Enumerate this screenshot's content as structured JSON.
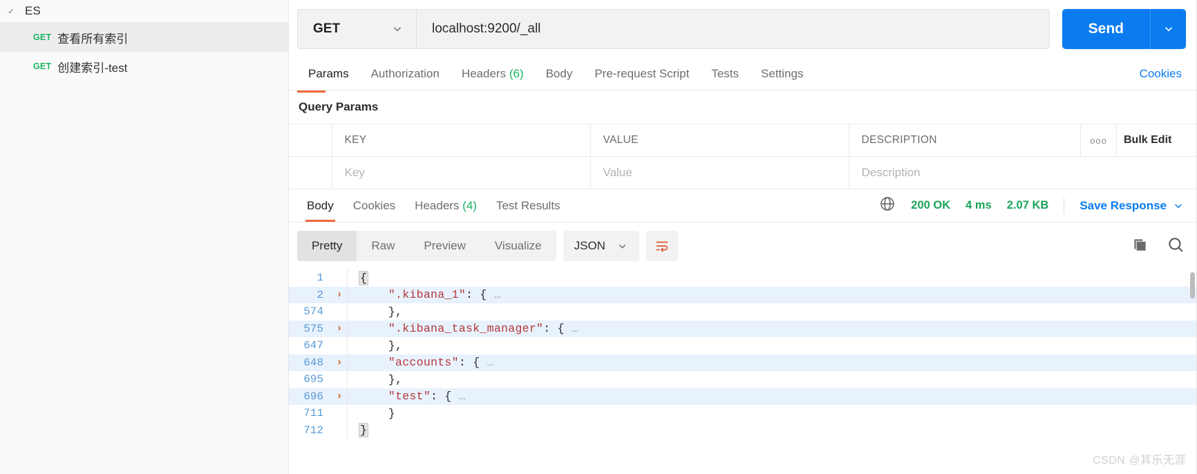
{
  "sidebar": {
    "collection": {
      "name": "ES",
      "chevron_icon": "chevron-down-icon"
    },
    "requests": [
      {
        "method": "GET",
        "label": "查看所有索引",
        "selected": true
      },
      {
        "method": "GET",
        "label": "创建索引-test",
        "selected": false
      }
    ]
  },
  "request": {
    "method": "GET",
    "url": "localhost:9200/_all",
    "send_label": "Send",
    "tabs": [
      {
        "label": "Params",
        "active": true
      },
      {
        "label": "Authorization",
        "active": false
      },
      {
        "label": "Headers",
        "count": "(6)",
        "active": false
      },
      {
        "label": "Body",
        "active": false
      },
      {
        "label": "Pre-request Script",
        "active": false
      },
      {
        "label": "Tests",
        "active": false
      },
      {
        "label": "Settings",
        "active": false
      }
    ],
    "cookies_link": "Cookies"
  },
  "query_params": {
    "title": "Query Params",
    "headers": [
      "KEY",
      "VALUE",
      "DESCRIPTION"
    ],
    "dots_label": "ooo",
    "bulk_edit_label": "Bulk Edit",
    "placeholders": {
      "key": "Key",
      "value": "Value",
      "description": "Description"
    }
  },
  "response": {
    "tabs": [
      {
        "label": "Body",
        "active": true
      },
      {
        "label": "Cookies",
        "active": false
      },
      {
        "label": "Headers",
        "count": "(4)",
        "active": false
      },
      {
        "label": "Test Results",
        "active": false
      }
    ],
    "globe_icon": "globe-icon",
    "status": "200 OK",
    "time": "4 ms",
    "size": "2.07 KB",
    "save_response_label": "Save Response",
    "view_modes": [
      {
        "label": "Pretty",
        "active": true
      },
      {
        "label": "Raw",
        "active": false
      },
      {
        "label": "Preview",
        "active": false
      },
      {
        "label": "Visualize",
        "active": false
      }
    ],
    "format": "JSON",
    "wrap_icon": "wrap-lines-icon",
    "copy_icon": "copy-icon",
    "search_icon": "search-icon",
    "body_lines": [
      {
        "num": "1",
        "fold": "",
        "text": "{",
        "highlight": false,
        "boxed": true
      },
      {
        "num": "2",
        "fold": "›",
        "text": "    \".kibana_1\": { …",
        "highlight": true,
        "boxed": false
      },
      {
        "num": "574",
        "fold": "",
        "text": "    },",
        "highlight": false,
        "boxed": false
      },
      {
        "num": "575",
        "fold": "›",
        "text": "    \".kibana_task_manager\": { …",
        "highlight": true,
        "boxed": false
      },
      {
        "num": "647",
        "fold": "",
        "text": "    },",
        "highlight": false,
        "boxed": false
      },
      {
        "num": "648",
        "fold": "›",
        "text": "    \"accounts\": { …",
        "highlight": true,
        "boxed": false
      },
      {
        "num": "695",
        "fold": "",
        "text": "    },",
        "highlight": false,
        "boxed": false
      },
      {
        "num": "696",
        "fold": "›",
        "text": "    \"test\": { …",
        "highlight": true,
        "boxed": false
      },
      {
        "num": "711",
        "fold": "",
        "text": "    }",
        "highlight": false,
        "boxed": false
      },
      {
        "num": "712",
        "fold": "",
        "text": "}",
        "highlight": false,
        "boxed": true
      }
    ]
  },
  "watermark": "CSDN @其乐无涯",
  "colors": {
    "accent_blue": "#0a7cf0",
    "method_green": "#19b562",
    "tab_orange": "#f1673b",
    "json_string": "#b5373a",
    "line_number": "#5b9bd5",
    "highlight_row": "#e8f2fd"
  }
}
